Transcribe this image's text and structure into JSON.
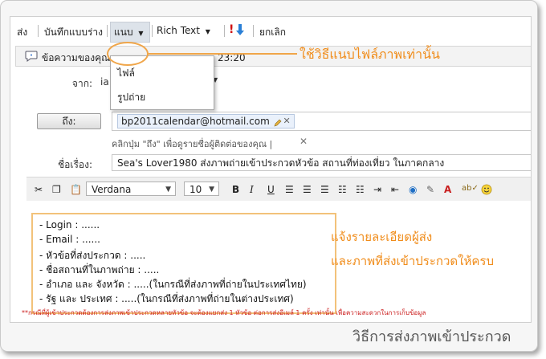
{
  "toolbar": {
    "send_label": "ส่ง",
    "save_draft_label": "บันทึกแบบร่าง",
    "attach_label": "แนบ",
    "rich_text_label": "Rich Text",
    "cancel_label": "ยกเลิก"
  },
  "infobar": {
    "text": "ข้อความของคุณ",
    "time": "อ 23:20"
  },
  "attach_menu": {
    "items": [
      "ไฟล์",
      "รูปถ่าย"
    ]
  },
  "callout": {
    "text": "ใช้วิธีแนบไฟล์ภาพเท่านั้น"
  },
  "form": {
    "from_label": "จาก:",
    "from_value": "ia",
    "to_button_label": "ถึง:",
    "to_recipient": "bp2011calendar@hotmail.com",
    "hint": "คลิกปุ่ม \"ถึง\" เพื่อดูรายชื่อผู้ติดต่อของคุณ  |",
    "subject_label": "ชื่อเรื่อง:",
    "subject_value": "Sea's Lover1980 ส่งภาพถ่ายเข้าประกวดหัวข้อ สถานที่ท่องเที่ยว ในภาคกลาง"
  },
  "format": {
    "font": "Verdana",
    "size": "10",
    "bold": "B",
    "italic": "I",
    "underline": "U"
  },
  "body": {
    "lines": [
      "- Login : ......",
      "- Email : ......",
      "- หัวข้อที่ส่งประกวด : .....",
      "- ชื่อสถานที่ในภาพถ่าย : .....",
      "- อำเภอ และ จังหวัด : .....(ในกรณีที่ส่งภาพที่ถ่ายในประเทศไทย)",
      "- รัฐ และ ประเทศ : .....(ในกรณีที่ส่งภาพที่ถ่ายในต่างประเทศ)"
    ]
  },
  "note": {
    "line1": "แจ้งรายละเอียดผู้ส่ง",
    "line2": "และภาพที่ส่งเข้าประกวดให้ครบ"
  },
  "footnote": "**กรณีที่ผู้เข้าประกวดต้องการส่งภาพเข้าประกวดหลายหัวข้อ จะต้องแยกส่ง 1 หัวข้อ ต่อการส่งอีเมล์ 1 ครั้ง เท่านั้น เพื่อความสะดวกในการเก็บข้อมูล",
  "caption": "วิธีการส่งภาพเข้าประกวด",
  "colors": {
    "accent_orange": "#f08c1a",
    "callout_border": "#f0a64a",
    "footnote_red": "#cc2020"
  }
}
